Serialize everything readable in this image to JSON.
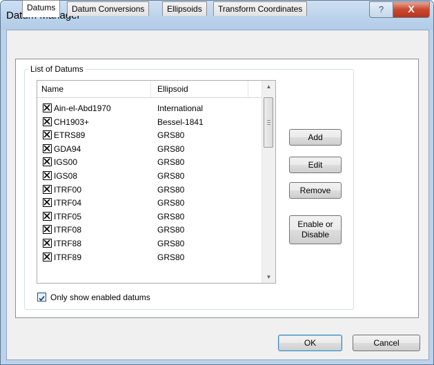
{
  "window": {
    "title": "Datum Manager",
    "help_glyph": "?",
    "close_glyph": "X"
  },
  "tabs": [
    {
      "label": "Datums",
      "active": true
    },
    {
      "label": "Datum Conversions",
      "active": false
    },
    {
      "label": "Ellipsoids",
      "active": false
    },
    {
      "label": "Transform Coordinates",
      "active": false
    }
  ],
  "group": {
    "label": "List of Datums"
  },
  "list": {
    "columns": [
      "Name",
      "Ellipsoid"
    ],
    "rows": [
      {
        "name": "Ain-el-Abd1970",
        "ellipsoid": "International",
        "enabled": true
      },
      {
        "name": "CH1903+",
        "ellipsoid": "Bessel-1841",
        "enabled": true
      },
      {
        "name": "ETRS89",
        "ellipsoid": "GRS80",
        "enabled": true
      },
      {
        "name": "GDA94",
        "ellipsoid": "GRS80",
        "enabled": true
      },
      {
        "name": "IGS00",
        "ellipsoid": "GRS80",
        "enabled": true
      },
      {
        "name": "IGS08",
        "ellipsoid": "GRS80",
        "enabled": true
      },
      {
        "name": "ITRF00",
        "ellipsoid": "GRS80",
        "enabled": true
      },
      {
        "name": "ITRF04",
        "ellipsoid": "GRS80",
        "enabled": true
      },
      {
        "name": "ITRF05",
        "ellipsoid": "GRS80",
        "enabled": true
      },
      {
        "name": "ITRF08",
        "ellipsoid": "GRS80",
        "enabled": true
      },
      {
        "name": "ITRF88",
        "ellipsoid": "GRS80",
        "enabled": true
      },
      {
        "name": "ITRF89",
        "ellipsoid": "GRS80",
        "enabled": true
      }
    ]
  },
  "side_buttons": {
    "add": "Add",
    "edit": "Edit",
    "remove": "Remove",
    "enable_line1": "Enable or",
    "enable_line2": "Disable"
  },
  "filter": {
    "label": "Only show enabled datums",
    "checked": true
  },
  "footer": {
    "ok": "OK",
    "cancel": "Cancel"
  },
  "colors": {
    "titlebar": "#bcd3ec",
    "close_button": "#c9482f",
    "default_button_border": "#3c7fb1"
  }
}
